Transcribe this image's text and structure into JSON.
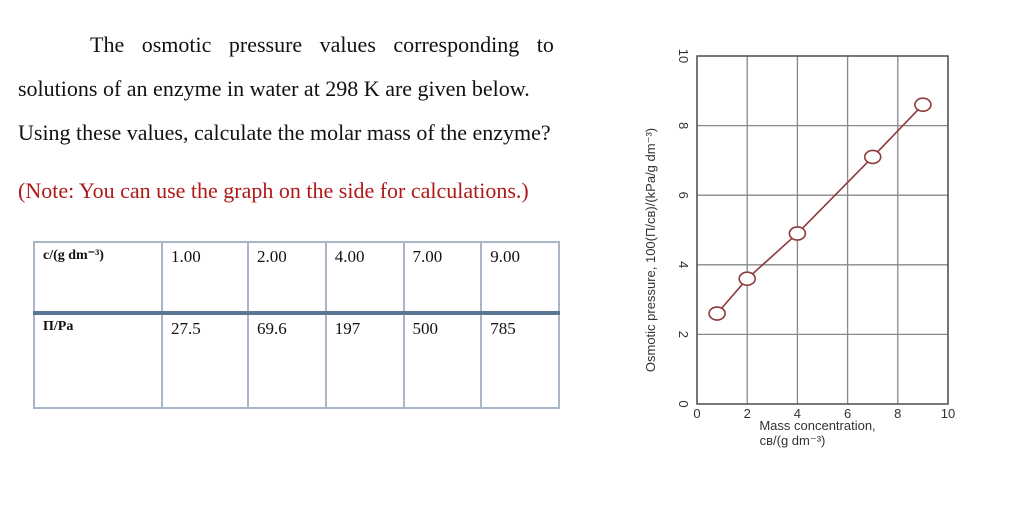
{
  "question": {
    "line1": "The osmotic pressure values corresponding to",
    "line2": "solutions of an enzyme in water at 298 K are given below.",
    "line3": "Using these values, calculate the molar mass of the enzyme?",
    "note": "(Note: You can use the graph on the side for calculations.)"
  },
  "table": {
    "row1_header": "c/(g dm⁻³)",
    "row1": [
      "1.00",
      "2.00",
      "4.00",
      "7.00",
      "9.00"
    ],
    "row2_header": "Π/Pa",
    "row2": [
      "27.5",
      "69.6",
      "197",
      "500",
      "785"
    ]
  },
  "chart_data": {
    "type": "line",
    "title": "",
    "xlabel_line1": "Mass concentration,",
    "xlabel_line2": "cʙ/(g dm⁻³)",
    "ylabel": "Osmotic pressure, 100(Π/cʙ)/(kPa/g dm⁻³)",
    "x": [
      0.8,
      2,
      4,
      7,
      9
    ],
    "y": [
      2.6,
      3.6,
      4.9,
      7.1,
      8.6
    ],
    "xlim": [
      0,
      10
    ],
    "ylim": [
      0,
      10
    ],
    "xticks": [
      "0",
      "2",
      "4",
      "6",
      "8",
      "10"
    ],
    "yticks": [
      "0",
      "2",
      "4",
      "6",
      "8",
      "10"
    ],
    "grid": true,
    "line_color": "#8b3a3a",
    "marker": "open-circle"
  }
}
